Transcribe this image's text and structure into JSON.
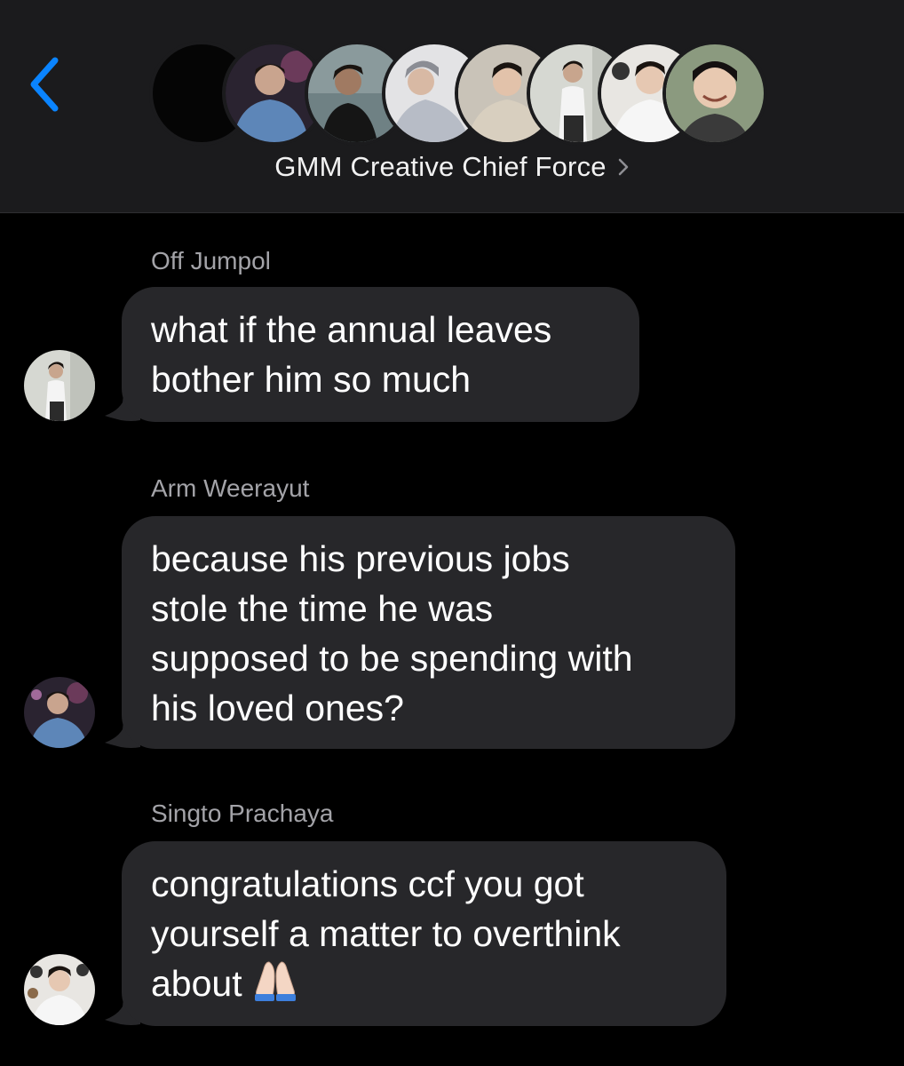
{
  "header": {
    "back_icon": "chevron-left-icon",
    "group_name": "GMM Creative Chief Force",
    "group_chevron_icon": "chevron-right-icon",
    "accent_color": "#0a84ff"
  },
  "messages": [
    {
      "sender": "Off Jumpol",
      "lines": [
        "what if the annual leaves",
        "bother him so much"
      ]
    },
    {
      "sender": "Arm Weerayut",
      "lines": [
        "because his previous jobs",
        "stole the time he was",
        "supposed to be spending with",
        "his loved ones?"
      ]
    },
    {
      "sender": "Singto Prachaya",
      "lines": [
        "congratulations ccf you got",
        "yourself a matter to overthink",
        "about"
      ],
      "trailing_icon": "folded-hands-emoji-icon"
    }
  ],
  "colors": {
    "bubble": "#27272a",
    "background": "#000000",
    "header": "#1b1b1d",
    "sender_text": "#a3a3a8"
  }
}
